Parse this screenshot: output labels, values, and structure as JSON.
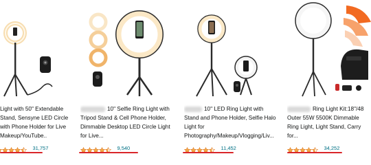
{
  "results": [
    {
      "title_lines": [
        "Light with 50\" Extendable",
        "Stand, Sensyne LED Circle",
        "with Phone Holder for Live",
        "Makeup/YouTube.."
      ],
      "rating": 4.5,
      "review_count": "31,757"
    },
    {
      "title_lines": [
        "10\" Selfie Ring Light with",
        "Tripod Stand & Cell Phone Holder,",
        "Dimmable Desktop LED Circle Light",
        "for Live..."
      ],
      "rating": 4.5,
      "review_count": "9,540"
    },
    {
      "title_lines": [
        "10'' LED Ring Light with",
        "Stand and Phone Holder, Selfie Halo",
        "Light for",
        "Photography/Makeup/Vlogging/Liv..."
      ],
      "rating": 4.5,
      "review_count": "11,452"
    },
    {
      "title_lines": [
        "Ring Light Kit:18\"/48",
        "Outer 55W 5500K Dimmable",
        "Ring Light, Light Stand, Carry",
        "for..."
      ],
      "rating": 4.5,
      "review_count": "34,252"
    }
  ],
  "colors": {
    "star": "#f3a847",
    "link": "#007185",
    "underline": "#d9262a",
    "title": "#0f1111"
  },
  "icons": [
    "star-icon"
  ]
}
